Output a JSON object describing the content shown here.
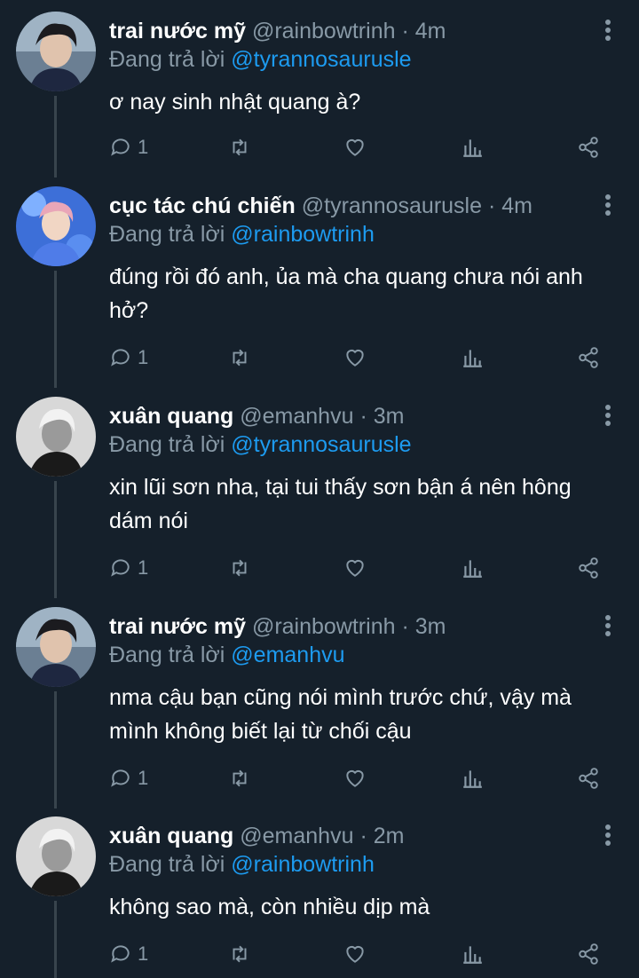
{
  "reply_prefix": "Đang trả lời",
  "colors": {
    "background": "#15202b",
    "muted": "#8899a6",
    "link": "#1d9bf0"
  },
  "tweets": [
    {
      "name": "trai nước mỹ",
      "handle": "@rainbowtrinh",
      "time": "4m",
      "reply_to": "@tyrannosaurusle",
      "text": "ơ nay sinh nhật quang à?",
      "reply_count": "1",
      "avatar": "avatar-dark-hair"
    },
    {
      "name": "cục tác chú chiến",
      "handle": "@tyrannosaurusle",
      "time": "4m",
      "reply_to": "@rainbowtrinh",
      "text": "đúng rồi đó anh, ủa mà cha quang chưa nói anh hở?",
      "reply_count": "1",
      "avatar": "avatar-blue"
    },
    {
      "name": "xuân quang",
      "handle": "@emanhvu",
      "time": "3m",
      "reply_to": "@tyrannosaurusle",
      "text": "xin lũi sơn nha, tại tui thấy sơn bận á nên hông dám nói",
      "reply_count": "1",
      "avatar": "avatar-mono"
    },
    {
      "name": "trai nước mỹ",
      "handle": "@rainbowtrinh",
      "time": "3m",
      "reply_to": "@emanhvu",
      "text": "nma cậu bạn cũng nói mình trước chứ, vậy mà mình không biết lại từ chối cậu",
      "reply_count": "1",
      "avatar": "avatar-dark-hair"
    },
    {
      "name": "xuân quang",
      "handle": "@emanhvu",
      "time": "2m",
      "reply_to": "@rainbowtrinh",
      "text": "không sao mà, còn nhiều dịp mà",
      "reply_count": "1",
      "avatar": "avatar-mono"
    }
  ]
}
